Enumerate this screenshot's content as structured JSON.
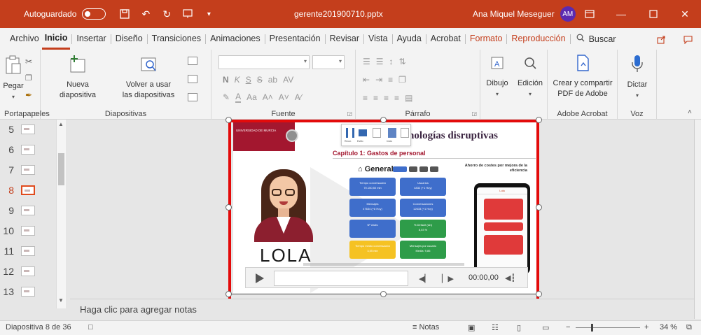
{
  "titlebar": {
    "autosave_label": "Autoguardado",
    "filename": "gerente201900710.pptx",
    "user_name": "Ana Miquel Meseguer",
    "user_initials": "AM"
  },
  "menu": {
    "tabs": [
      "Archivo",
      "Inicio",
      "Insertar",
      "Diseño",
      "Transiciones",
      "Animaciones",
      "Presentación",
      "Revisar",
      "Vista",
      "Ayuda",
      "Acrobat",
      "Formato",
      "Reproducción"
    ],
    "active_tab": "Inicio",
    "search_label": "Buscar"
  },
  "ribbon": {
    "clipboard": {
      "paste_label": "Pegar",
      "group_label": "Portapapeles"
    },
    "slides": {
      "new_slide_label": "Nueva",
      "new_slide_label2": "diapositiva",
      "reuse_label": "Volver a usar",
      "reuse_label2": "las diapositivas",
      "group_label": "Diapositivas"
    },
    "font": {
      "group_label": "Fuente"
    },
    "paragraph": {
      "group_label": "Párrafo"
    },
    "drawing": {
      "draw_label": "Dibujo"
    },
    "editing": {
      "edit_label": "Edición"
    },
    "adobe": {
      "create_label": "Crear y compartir",
      "create_label2": "PDF de Adobe",
      "group_label": "Adobe Acrobat"
    },
    "voice": {
      "dictate_label": "Dictar",
      "group_label": "Voz"
    }
  },
  "thumbnails": [
    {
      "num": "5"
    },
    {
      "num": "6"
    },
    {
      "num": "7"
    },
    {
      "num": "8",
      "selected": true
    },
    {
      "num": "9"
    },
    {
      "num": "10"
    },
    {
      "num": "11"
    },
    {
      "num": "12"
    },
    {
      "num": "13"
    }
  ],
  "slide": {
    "logo_text": "UNIVERSIDAD DE MURCIA",
    "title": "de tecnologías disruptivas",
    "subtitle": "Capítulo 1: Gastos de personal",
    "avatar_name": "LOLA",
    "dashboard_header": "General",
    "side_title": "Ahorro de costes por mejora de la eficiencia",
    "phone_header": "Lola",
    "kpis": [
      {
        "label": "Tiempo conversación",
        "value": "70.150,50 min",
        "color": "#3f6ecb"
      },
      {
        "label": "Usuarios",
        "value": "4832 (+1 Hoy)",
        "color": "#3f6ecb"
      },
      {
        "label": "Mensajes",
        "value": "47634 (+8 Hoy)",
        "color": "#3f6ecb"
      },
      {
        "label": "Conversaciones",
        "value": "12633 (+1 Hoy)",
        "color": "#3f6ecb"
      },
      {
        "label": "Nº chats",
        "value": "",
        "color": "#3f6ecb"
      },
      {
        "label": "% Default (sin)",
        "value": "8,03 %",
        "color": "#2e9c49"
      },
      {
        "label": "Tiempo medio conversación",
        "value": "3,55 min",
        "color": "#f5c223"
      },
      {
        "label": "Mensajes por usuario",
        "value": "Media: 9,86",
        "color": "#2e9c49"
      }
    ],
    "floating_toolbar": [
      "Recor.",
      "Estilo",
      "",
      "Inicio",
      ""
    ]
  },
  "media": {
    "time": "00:00,00"
  },
  "notes": {
    "placeholder": "Haga clic para agregar notas"
  },
  "statusbar": {
    "slide_info": "Diapositiva 8 de 36",
    "notes_label": "Notas",
    "zoom": "34 %"
  }
}
